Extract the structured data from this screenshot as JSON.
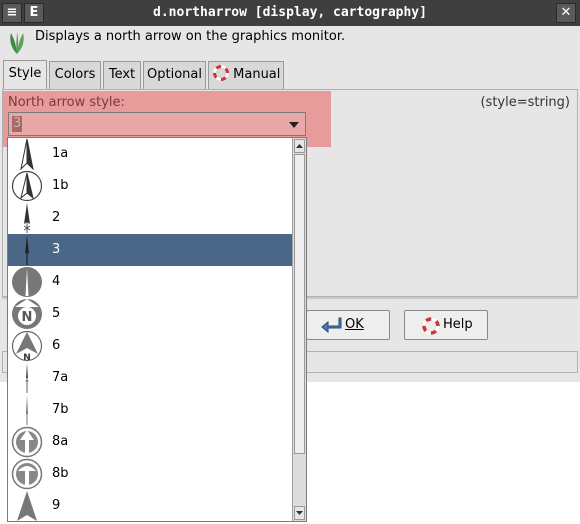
{
  "titlebar": {
    "title": "d.northarrow [display, cartography]",
    "menu_btn": "≡",
    "e_btn": "E",
    "close_btn": "✕"
  },
  "description": "Displays a north arrow on the graphics monitor.",
  "tabs": [
    {
      "label": "Style",
      "active": true
    },
    {
      "label": "Colors",
      "active": false
    },
    {
      "label": "Text",
      "active": false
    },
    {
      "label": "Optional",
      "active": false
    },
    {
      "label": "Manual",
      "active": false
    }
  ],
  "field": {
    "label": "North arrow style:",
    "type_hint": "(style=string)",
    "value": "3"
  },
  "buttons": {
    "ok": "OK",
    "help": "Help"
  },
  "dropdown": {
    "options": [
      {
        "label": "1a",
        "icon": "arrow-1a-icon"
      },
      {
        "label": "1b",
        "icon": "arrow-1b-icon"
      },
      {
        "label": "2",
        "icon": "arrow-2-icon"
      },
      {
        "label": "3",
        "icon": "arrow-3-icon",
        "selected": true
      },
      {
        "label": "4",
        "icon": "arrow-4-icon"
      },
      {
        "label": "5",
        "icon": "arrow-5-icon"
      },
      {
        "label": "6",
        "icon": "arrow-6-icon"
      },
      {
        "label": "7a",
        "icon": "arrow-7a-icon"
      },
      {
        "label": "7b",
        "icon": "arrow-7b-icon"
      },
      {
        "label": "8a",
        "icon": "arrow-8a-icon"
      },
      {
        "label": "8b",
        "icon": "arrow-8b-icon"
      },
      {
        "label": "9",
        "icon": "arrow-9-icon"
      }
    ]
  },
  "colors": {
    "titlebar": "#3f3f3f",
    "selection": "#4a6787",
    "highlight": "#e89b9b"
  }
}
